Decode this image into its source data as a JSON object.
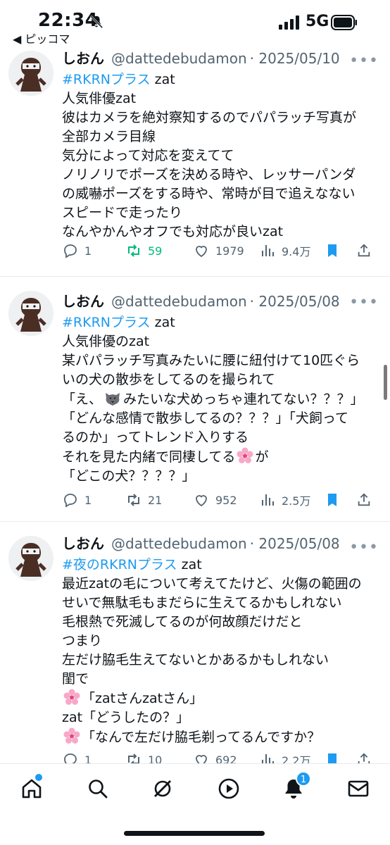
{
  "status_bar": {
    "time": "22:34",
    "back_app": "◀ ピッコマ",
    "network": "5G"
  },
  "tweets": [
    {
      "name": "しおん",
      "handle": "@dattedebudamon",
      "date": "· 2025/05/10",
      "hashtag": "#RKRNプラス",
      "hashtag_suffix": " zat",
      "lines": [
        "人気俳優zat",
        "彼はカメラを絶対察知するのでパパラッチ写真が",
        "全部カメラ目線",
        "気分によって対応を変えてて",
        "ノリノリでポーズを決める時や、レッサーパンダ",
        "の威嚇ポーズをする時や、常時が目で追えなない",
        "スピードで走ったり",
        "なんやかんやオフでも対応が良いzat"
      ],
      "replies": "1",
      "retweets": "59",
      "likes": "1979",
      "views": "9.4万"
    },
    {
      "name": "しおん",
      "handle": "@dattedebudamon",
      "date": "· 2025/05/08",
      "hashtag": "#RKRNプラス",
      "hashtag_suffix": " zat",
      "lines": [
        "人気俳優のzat",
        "某パパラッチ写真みたいに腰に紐付けて10匹ぐら",
        "いの犬の散歩をしてるのを撮られて",
        "「え、",
        "みたいな犬めっちゃ連れてない？？？」",
        "「どんな感情で散歩してるの？？？」「犬飼って",
        "るのか」ってトレンド入りする",
        "それを見た内緒で同棲してる",
        "が",
        "「どこの犬？？？？」"
      ],
      "replies": "1",
      "retweets": "21",
      "likes": "952",
      "views": "2.5万"
    },
    {
      "name": "しおん",
      "handle": "@dattedebudamon",
      "date": "· 2025/05/08",
      "hashtag": "#夜のRKRNプラス",
      "hashtag_suffix": " zat",
      "lines": [
        "最近zatの毛について考えてたけど、火傷の範囲の",
        "せいで無駄毛もまだらに生えてるかもしれない",
        "毛根熱で死滅してるのが何故顔だけだと",
        "つまり",
        "左だけ脇毛生えてないとかあるかもしれない",
        "閨で",
        "「zatさんzatさん」",
        "zat「どうしたの？」",
        "「なんで左だけ脇毛剃ってるんですか？"
      ],
      "replies": "1",
      "retweets": "10",
      "likes": "692",
      "views": "2.2万"
    }
  ],
  "bottom_nav": {
    "notification_count": "1"
  },
  "colors": {
    "accent": "#1d9bf0",
    "retweet_active": "#00ba7c",
    "muted": "#536471"
  }
}
